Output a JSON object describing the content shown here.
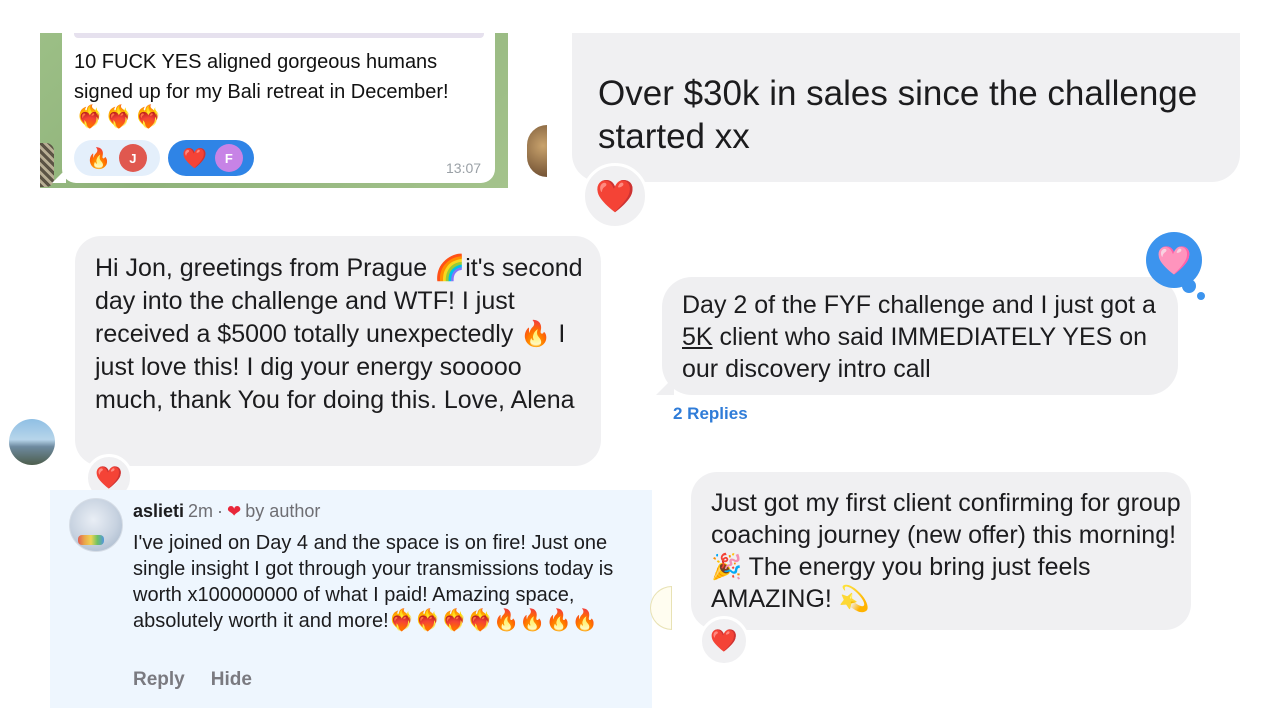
{
  "telegram": {
    "message": "10 FUCK YES aligned gorgeous humans signed up for my Bali retreat in December!",
    "emojis": "❤️‍🔥❤️‍🔥❤️‍🔥",
    "reactions": [
      {
        "emoji": "🔥",
        "avatar_letter": "J",
        "avatar_color": "#e0584f",
        "selected": false
      },
      {
        "emoji": "❤️",
        "avatar_letter": "F",
        "avatar_color": "#c783e6",
        "selected": true
      }
    ],
    "time": "13:07"
  },
  "sales": {
    "message": "Over $30k in sales since the challenge started xx",
    "reaction": "❤️"
  },
  "prague": {
    "message_parts": [
      "Hi Jon, greetings from Prague ",
      "🌈",
      "it's second day into the challenge and WTF! I just received a $5000 totally unexpectedly ",
      "🔥",
      " I just love this! I dig your energy sooooo much, thank You for doing this. Love, Alena"
    ],
    "reaction": "❤️"
  },
  "fyf": {
    "message_before": "Day 2 of the FYF challenge and I just got a ",
    "underlined": "5K",
    "message_after": " client who said IMMEDIATELY YES on our discovery intro call",
    "thought_emoji": "🩷",
    "replies": "2 Replies"
  },
  "comment": {
    "username": "aslieti",
    "time": "2m",
    "separator": "·",
    "heart": "❤",
    "by_author": "by author",
    "text": "I've joined on Day 4 and the space is on fire! Just one single insight I got through your transmissions today is worth x100000000 of what I paid! Amazing space, absolutely worth it and more!",
    "text_emojis": "❤️‍🔥❤️‍🔥❤️‍🔥❤️‍🔥🔥🔥🔥🔥",
    "reply_label": "Reply",
    "hide_label": "Hide"
  },
  "coaching": {
    "message_parts": [
      "Just got my first client confirming for group coaching journey (new offer) this morning! ",
      "🎉",
      " The energy you bring just feels AMAZING! ",
      "💫"
    ],
    "reaction": "❤️"
  }
}
